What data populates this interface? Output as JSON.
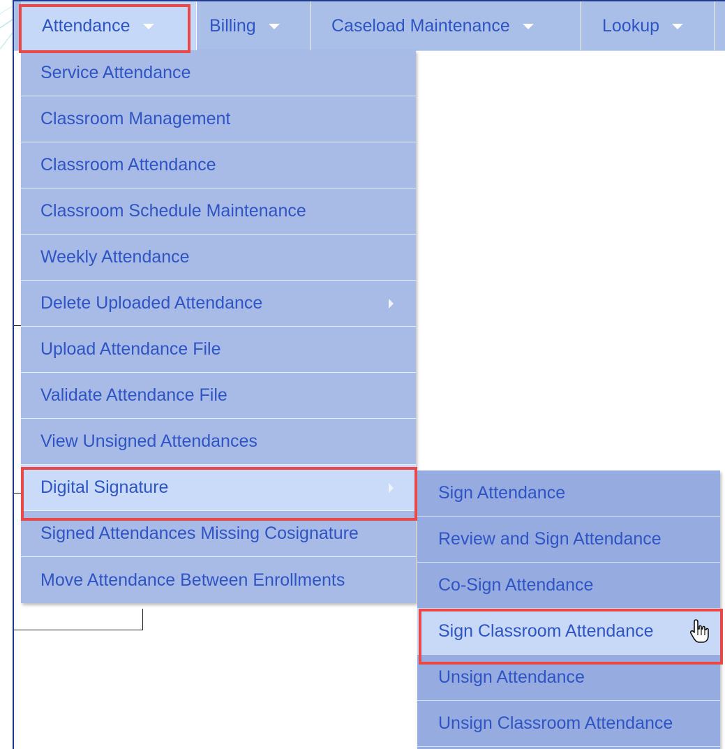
{
  "colors": {
    "menubar_bg": "#a9bfe7",
    "menu_bg": "#a8bae6",
    "submenu_bg": "#96abe0",
    "active_bg": "#c9dbf9",
    "text": "#2f54c4",
    "highlight": "#e84848"
  },
  "menubar": {
    "items": [
      {
        "label": "Attendance"
      },
      {
        "label": "Billing"
      },
      {
        "label": "Caseload Maintenance"
      },
      {
        "label": "Lookup"
      }
    ]
  },
  "attendance_menu": {
    "items": [
      {
        "label": "Service Attendance"
      },
      {
        "label": "Classroom Management"
      },
      {
        "label": "Classroom Attendance"
      },
      {
        "label": "Classroom Schedule Maintenance"
      },
      {
        "label": "Weekly Attendance"
      },
      {
        "label": "Delete Uploaded Attendance"
      },
      {
        "label": "Upload Attendance File"
      },
      {
        "label": "Validate Attendance File"
      },
      {
        "label": "View Unsigned Attendances"
      },
      {
        "label": "Digital Signature"
      },
      {
        "label": "Signed Attendances Missing Cosignature"
      },
      {
        "label": "Move Attendance Between Enrollments"
      }
    ]
  },
  "digital_signature_menu": {
    "items": [
      {
        "label": "Sign Attendance"
      },
      {
        "label": "Review and Sign Attendance"
      },
      {
        "label": "Co-Sign Attendance"
      },
      {
        "label": "Sign Classroom Attendance"
      },
      {
        "label": "Unsign Attendance"
      },
      {
        "label": "Unsign Classroom Attendance"
      }
    ]
  },
  "icons": [
    "caret-down-icon",
    "arrow-right-icon",
    "hand-cursor-icon"
  ]
}
